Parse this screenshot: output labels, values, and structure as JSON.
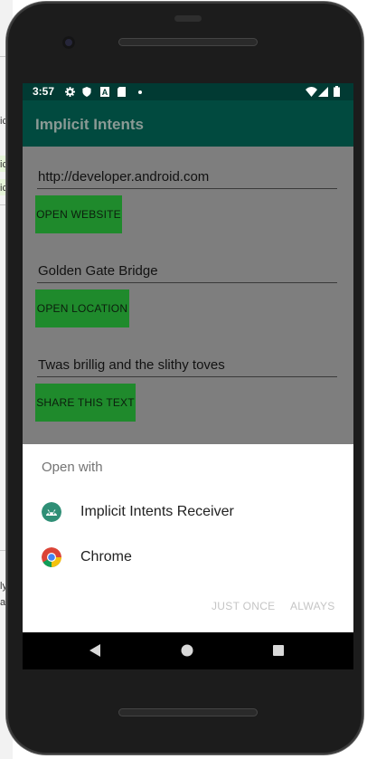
{
  "ide": {
    "fragments": [
      "ic",
      "ic",
      "ic",
      "ly",
      "ar"
    ]
  },
  "status_bar": {
    "time": "3:57",
    "left_icons": [
      "gear-icon",
      "shield-icon",
      "a-box-icon",
      "sd-card-icon",
      "dot-icon"
    ],
    "right_icons": [
      "wifi-icon",
      "signal-icon",
      "battery-icon"
    ]
  },
  "app_bar": {
    "title": "Implicit Intents",
    "color": "#014a3f"
  },
  "main": {
    "website_field": "http://developer.android.com",
    "open_website_label": "OPEN WEBSITE",
    "location_field": "Golden Gate Bridge",
    "open_location_label": "OPEN LOCATION",
    "share_field": "Twas brillig and the slithy toves",
    "share_text_label": "SHARE THIS TEXT",
    "button_color": "#1f8a2c"
  },
  "sheet": {
    "heading": "Open with",
    "apps": [
      {
        "label": "Implicit Intents Receiver",
        "icon": "android-icon"
      },
      {
        "label": "Chrome",
        "icon": "chrome-icon"
      }
    ],
    "just_once_label": "JUST ONCE",
    "always_label": "ALWAYS"
  },
  "nav_bar": {
    "buttons": [
      "back-icon",
      "home-icon",
      "recents-icon"
    ]
  }
}
